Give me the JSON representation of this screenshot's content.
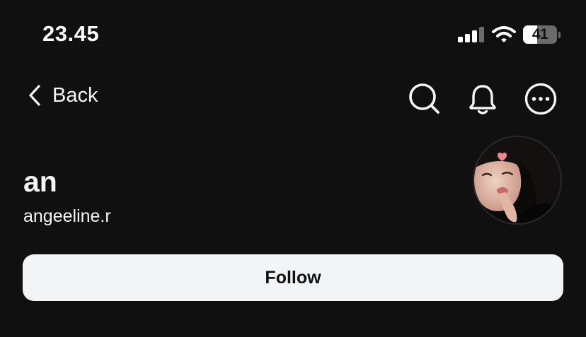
{
  "status_bar": {
    "time": "23.45",
    "battery_level": "41",
    "battery_fraction": 0.41,
    "icons": [
      "signal-icon",
      "wifi-icon",
      "battery-icon"
    ]
  },
  "nav": {
    "back_label": "Back",
    "back_icon": "chevron-left-icon",
    "actions": [
      "search-icon",
      "bell-icon",
      "more-icon"
    ]
  },
  "profile": {
    "display_name": "an",
    "username": "angeeline.r",
    "avatar": "profile-photo"
  },
  "follow_button": {
    "label": "Follow"
  },
  "colors": {
    "background": "#101010",
    "text": "#f3f5f7",
    "button_bg": "#f3f4f6",
    "button_text": "#111111"
  }
}
